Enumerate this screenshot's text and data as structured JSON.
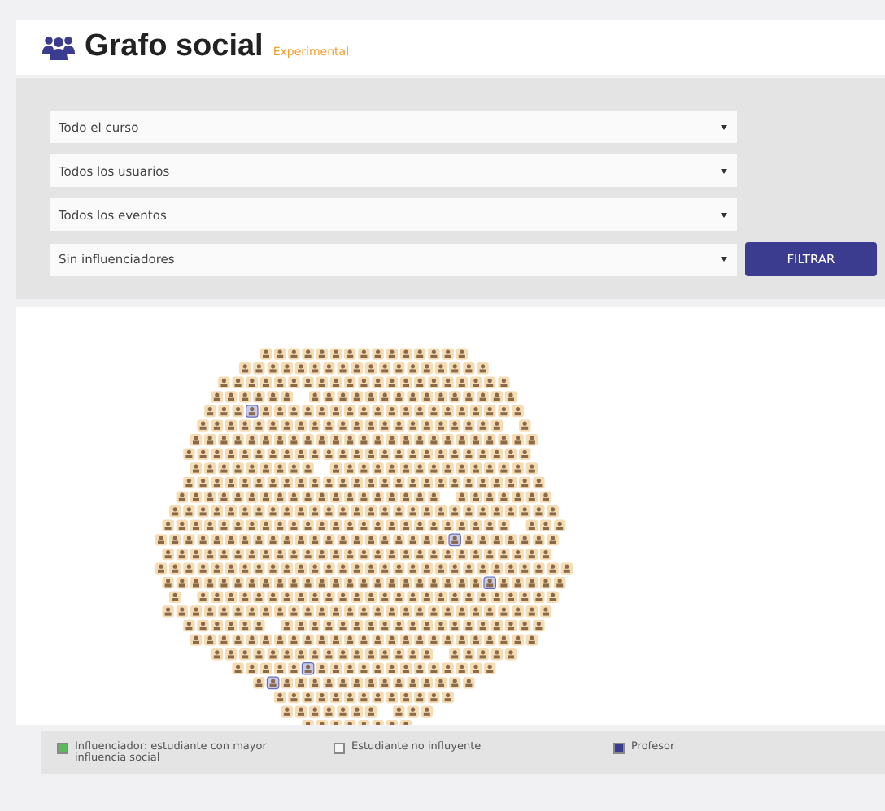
{
  "header": {
    "title": "Grafo social",
    "badge": "Experimental"
  },
  "filters": [
    {
      "value": "Todo el curso"
    },
    {
      "value": "Todos los usuarios"
    },
    {
      "value": "Todos los eventos"
    },
    {
      "value": "Sin influenciadores"
    }
  ],
  "filter_button": "FILTRAR",
  "legend": [
    {
      "label": "Influenciador: estudiante con mayor influencia social",
      "color": "#5cb85c"
    },
    {
      "label": "Estudiante no influyente",
      "color": "#f4f4f4"
    },
    {
      "label": "Profesor",
      "color": "#3b3b8f"
    }
  ]
}
